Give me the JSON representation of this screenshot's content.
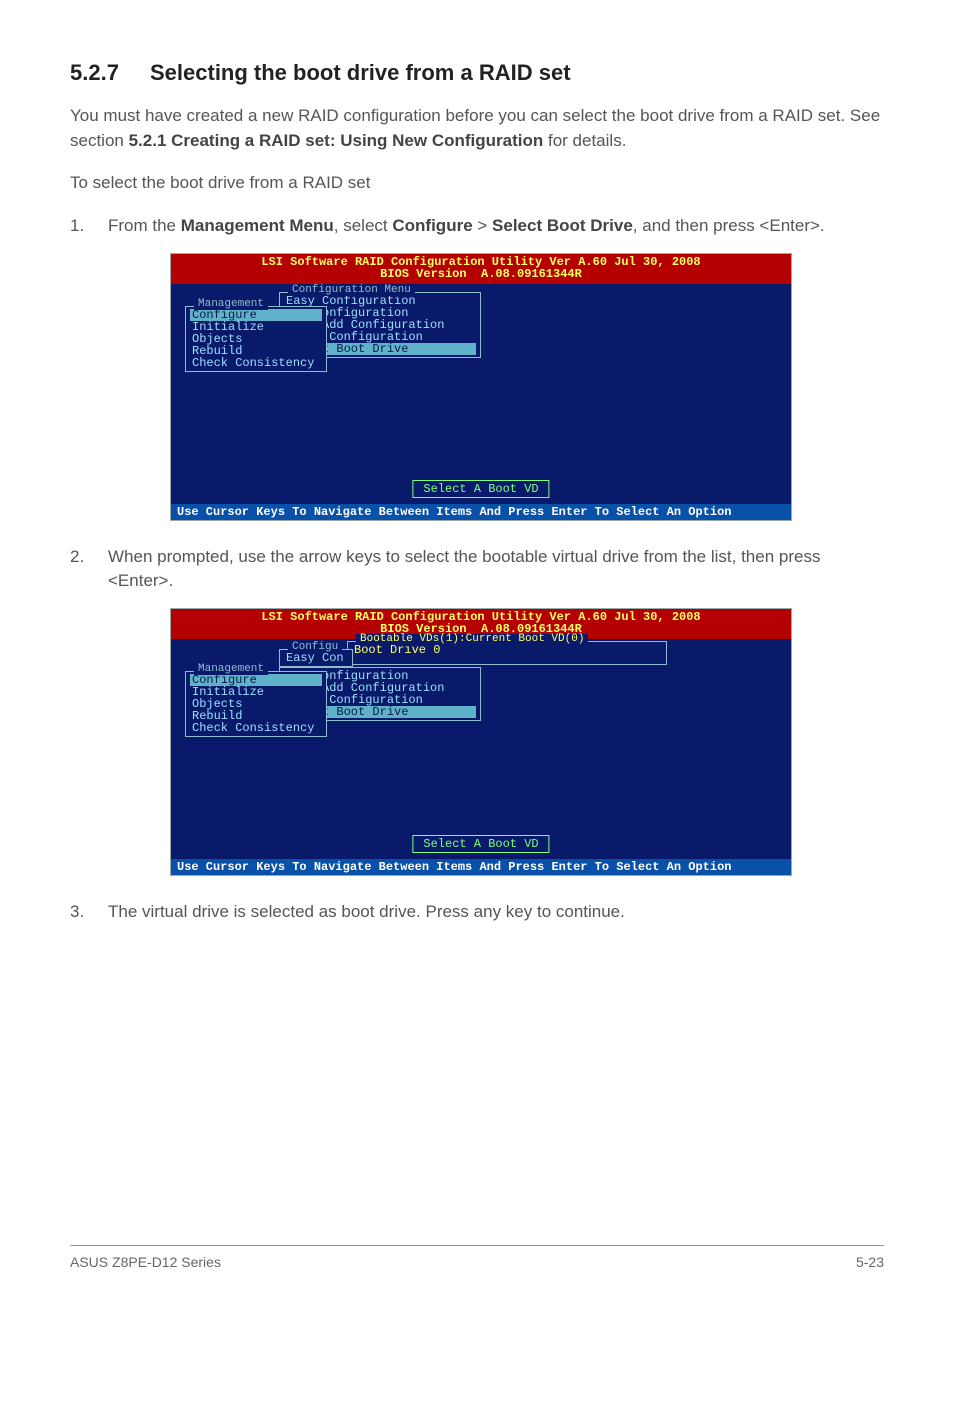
{
  "heading": {
    "number": "5.2.7",
    "title": "Selecting the boot drive from a RAID set"
  },
  "intro": {
    "p1_a": "You must have created a new RAID configuration before you can select the boot drive from a RAID set. See section ",
    "p1_bold": "5.2.1 Creating a RAID set: Using New Configuration",
    "p1_b": " for details.",
    "p2": "To select the boot drive from a RAID set"
  },
  "steps": {
    "s1": {
      "num": "1.",
      "a": "From the ",
      "b1": "Management Menu",
      "b": ", select ",
      "b2": "Configure",
      "c": " > ",
      "b3": "Select Boot Drive",
      "d": ", and then press <Enter>."
    },
    "s2": {
      "num": "2.",
      "text": "When prompted, use the arrow keys to select the bootable virtual drive from the list, then press <Enter>."
    },
    "s3": {
      "num": "3.",
      "text": "The virtual drive is selected as boot drive. Press any key to continue."
    }
  },
  "bios": {
    "title_line1": "LSI Software RAID Configuration Utility Ver A.60 Jul 30, 2008",
    "title_line2": "BIOS Version  A.08.09161344R",
    "mgmt_caption": "Management",
    "mgmt_items": [
      "Configure",
      "Initialize",
      "Objects",
      "Rebuild",
      "Check Consistency"
    ],
    "cfg_caption": "Configuration Menu",
    "cfg_items": [
      "Easy Configuration",
      "New Configuration",
      "View/Add Configuration",
      "Clear Configuration",
      "Select Boot Drive"
    ],
    "mini_caption": "Configu",
    "mini_item": "Easy Con",
    "boot_caption": "Bootable VDs(1):Current Boot VD(0)",
    "boot_item": "Boot Drive 0",
    "select_vd": "Select A Boot VD",
    "footer": "Use Cursor Keys To Navigate Between Items And Press Enter To Select An Option"
  },
  "page_footer": {
    "left": "ASUS Z8PE-D12 Series",
    "right": "5-23"
  }
}
